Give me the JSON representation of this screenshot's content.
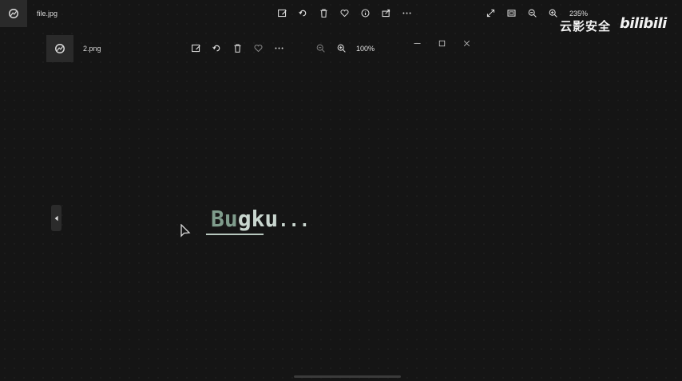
{
  "back_window": {
    "file_name": "file.jpg",
    "zoom": "235%",
    "toolbar": [
      "edit-image",
      "rotate",
      "delete",
      "favorite",
      "info",
      "share",
      "more"
    ],
    "view_controls": [
      "expand",
      "fit",
      "zoom-out",
      "zoom-in"
    ]
  },
  "front_window": {
    "file_name": "2.png",
    "zoom": "100%",
    "toolbar": [
      "edit-image",
      "rotate",
      "delete",
      "favorite",
      "more"
    ],
    "window_controls": [
      "minimize",
      "maximize",
      "close"
    ]
  },
  "image_content": {
    "text": "Bugku...",
    "text_first": "Bu",
    "text_middle": "gku",
    "text_end": "..."
  },
  "watermark": {
    "chinese": "云影安全",
    "logo": "bilibili"
  },
  "colors": {
    "background": "#151515",
    "text": "#e6e6e6"
  }
}
